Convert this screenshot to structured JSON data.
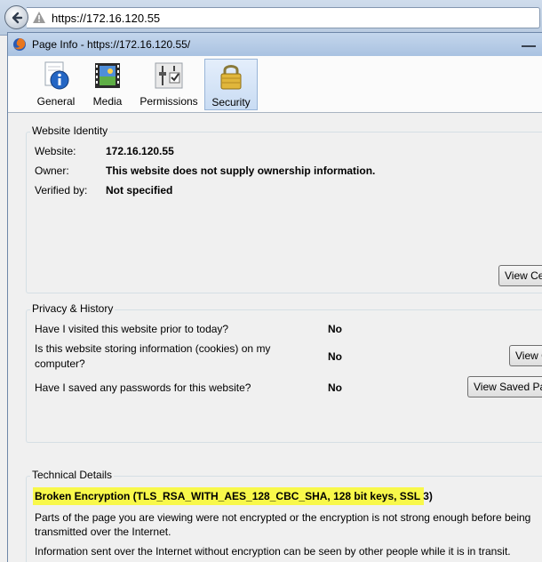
{
  "browser": {
    "url": "https://172.16.120.55"
  },
  "dialog": {
    "title": "Page Info - https://172.16.120.55/"
  },
  "tabs": [
    {
      "label": "General",
      "icon": "info-icon"
    },
    {
      "label": "Media",
      "icon": "film-icon"
    },
    {
      "label": "Permissions",
      "icon": "sliders-checkbox-icon"
    },
    {
      "label": "Security",
      "icon": "padlock-icon"
    }
  ],
  "selected_tab": "Security",
  "website_identity": {
    "title": "Website Identity",
    "website_label": "Website:",
    "website_value": "172.16.120.55",
    "owner_label": "Owner:",
    "owner_value": "This website does not supply ownership information.",
    "verified_label": "Verified by:",
    "verified_value": "Not specified",
    "view_button": "View Cer"
  },
  "privacy_history": {
    "title": "Privacy & History",
    "q1": "Have I visited this website prior to today?",
    "a1": "No",
    "q2_line1": "Is this website storing information (cookies) on my",
    "q2_line2": "computer?",
    "a2": "No",
    "q3": "Have I saved any passwords for this website?",
    "a3": "No",
    "view_cookies_button": "View C",
    "view_passwords_button": "View Saved Pas"
  },
  "technical_details": {
    "title": "Technical Details",
    "header": "Broken Encryption (TLS_RSA_WITH_AES_128_CBC_SHA, 128 bit keys, SSL 3)",
    "para1_line1": "Parts of the page you are viewing were not encrypted or the encryption is not strong enough before being",
    "para1_line2": "transmitted over the Internet.",
    "para2": "Information sent over the Internet without encryption can be seen by other people while it is in transit.",
    "highlight_color": "#f8f84a"
  }
}
